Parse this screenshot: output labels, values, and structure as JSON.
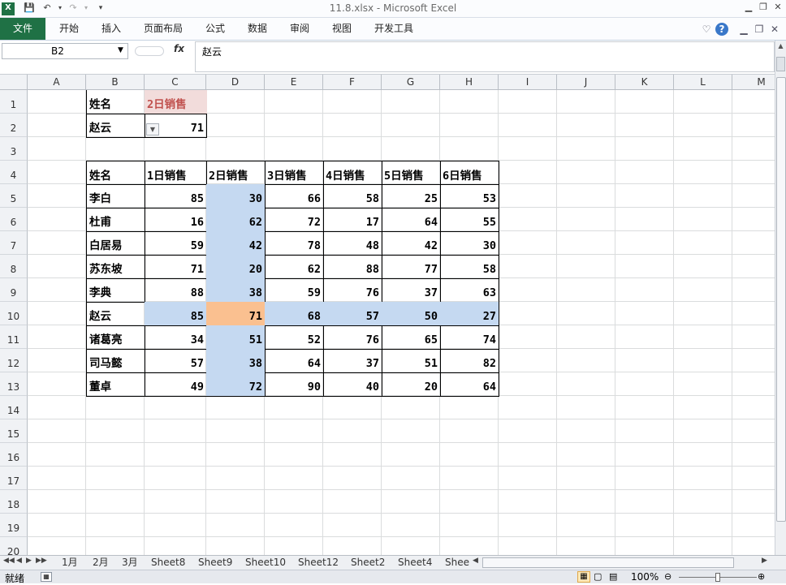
{
  "app": {
    "title": "11.8.xlsx  -  Microsoft Excel",
    "file_tab": "文件",
    "ribbon_tabs": [
      "开始",
      "插入",
      "页面布局",
      "公式",
      "数据",
      "审阅",
      "视图",
      "开发工具"
    ]
  },
  "formula_bar": {
    "name_box": "B2",
    "fx": "fx",
    "content": "赵云"
  },
  "columns": [
    "A",
    "B",
    "C",
    "D",
    "E",
    "F",
    "G",
    "H",
    "I",
    "J",
    "K",
    "L",
    "M"
  ],
  "rows": [
    "1",
    "2",
    "3",
    "4",
    "5",
    "6",
    "7",
    "8",
    "9",
    "10",
    "11",
    "12",
    "13",
    "14",
    "15",
    "16",
    "17",
    "18",
    "19",
    "20"
  ],
  "lookup": {
    "header_name": "姓名",
    "header_sales": "2日销售",
    "name_value": "赵云",
    "sales_value": "71"
  },
  "table": {
    "headers": [
      "姓名",
      "1日销售",
      "2日销售",
      "3日销售",
      "4日销售",
      "5日销售",
      "6日销售"
    ],
    "rows": [
      [
        "李白",
        "85",
        "30",
        "66",
        "58",
        "25",
        "53"
      ],
      [
        "杜甫",
        "16",
        "62",
        "72",
        "17",
        "64",
        "55"
      ],
      [
        "白居易",
        "59",
        "42",
        "78",
        "48",
        "42",
        "30"
      ],
      [
        "苏东坡",
        "71",
        "20",
        "62",
        "88",
        "77",
        "58"
      ],
      [
        "李典",
        "88",
        "38",
        "59",
        "76",
        "37",
        "63"
      ],
      [
        "赵云",
        "85",
        "71",
        "68",
        "57",
        "50",
        "27"
      ],
      [
        "诸葛亮",
        "34",
        "51",
        "52",
        "76",
        "65",
        "74"
      ],
      [
        "司马懿",
        "57",
        "38",
        "64",
        "37",
        "51",
        "82"
      ],
      [
        "董卓",
        "49",
        "72",
        "90",
        "40",
        "20",
        "64"
      ]
    ]
  },
  "sheets": [
    "1月",
    "2月",
    "3月",
    "Sheet8",
    "Sheet9",
    "Sheet10",
    "Sheet12",
    "Sheet2",
    "Sheet4",
    "Shee"
  ],
  "status": {
    "ready": "就绪",
    "zoom": "100%"
  },
  "colors": {
    "highlight_blue": "#c5d9f1",
    "highlight_orange": "#fac090",
    "header_pink": "#f2dcdb",
    "file_tab": "#1f7145"
  }
}
